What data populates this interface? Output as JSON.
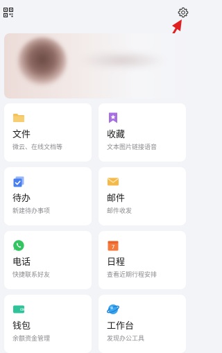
{
  "header": {
    "qr_icon": "qr-code-icon",
    "settings_icon": "gear-icon",
    "arrow_color": "#e02020"
  },
  "profile": {
    "avatar_blurred": true
  },
  "cards": [
    {
      "title": "文件",
      "subtitle": "微云、在线文档等",
      "icon": "folder-icon",
      "color": "#f5c15a"
    },
    {
      "title": "收藏",
      "subtitle": "文本图片链接语音",
      "icon": "bookmark-icon",
      "color": "#a86fe0"
    },
    {
      "title": "待办",
      "subtitle": "新建待办事项",
      "icon": "todo-icon",
      "color": "#4a7ff0"
    },
    {
      "title": "邮件",
      "subtitle": "邮件收发",
      "icon": "mail-icon",
      "color": "#f5b94a"
    },
    {
      "title": "电话",
      "subtitle": "快捷联系好友",
      "icon": "phone-icon",
      "color": "#35c462"
    },
    {
      "title": "日程",
      "subtitle": "查看近期行程安排",
      "icon": "calendar-icon",
      "color": "#f47a3c",
      "calendar_day": "7"
    },
    {
      "title": "钱包",
      "subtitle": "余额资金管理",
      "icon": "wallet-icon",
      "color": "#2fc39a"
    },
    {
      "title": "工作台",
      "subtitle": "发现办公工具",
      "icon": "workbench-icon",
      "color": "#3aa6f0"
    }
  ]
}
